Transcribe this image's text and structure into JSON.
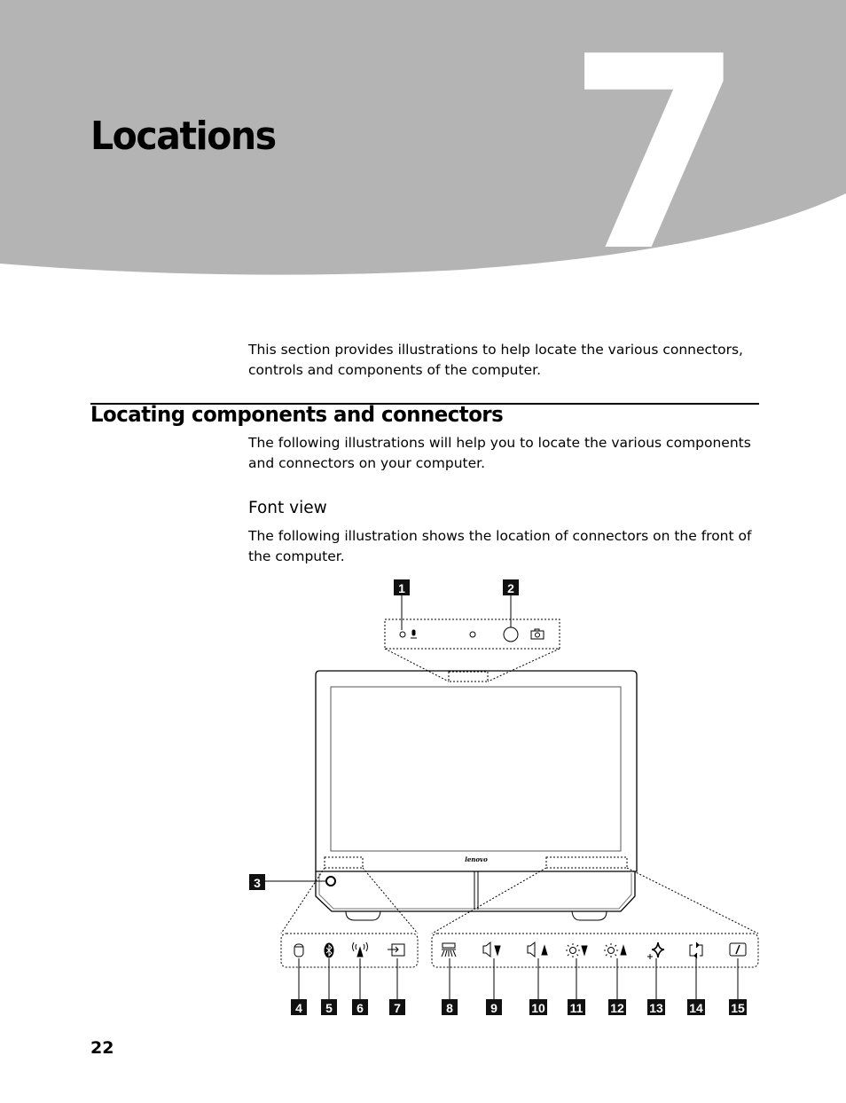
{
  "chapter": {
    "number": "7",
    "title": "Locations",
    "banner_color": "#b4b4b4"
  },
  "intro": "This section provides illustrations to help locate the various connectors, controls and components of the computer.",
  "section": {
    "heading": "Locating components and connectors",
    "text": "The following illustrations will help you to locate the various components and connectors on your computer."
  },
  "subsection": {
    "heading": "Font view",
    "text": "The following illustration shows the location of connectors on the front of the computer."
  },
  "figure": {
    "brand_logo": "lenovo",
    "callouts": [
      {
        "number": "1",
        "icon": "microphone-icon"
      },
      {
        "number": "2",
        "icon": "camera-icon"
      },
      {
        "number": "3",
        "icon": "power-button-icon"
      },
      {
        "number": "4",
        "icon": "hard-drive-indicator-icon"
      },
      {
        "number": "5",
        "icon": "bluetooth-icon"
      },
      {
        "number": "6",
        "icon": "wireless-icon"
      },
      {
        "number": "7",
        "icon": "input-source-icon"
      },
      {
        "number": "8",
        "icon": "backlight-icon"
      },
      {
        "number": "9",
        "icon": "volume-down-icon"
      },
      {
        "number": "10",
        "icon": "volume-up-icon"
      },
      {
        "number": "11",
        "icon": "brightness-down-icon"
      },
      {
        "number": "12",
        "icon": "brightness-up-icon"
      },
      {
        "number": "13",
        "icon": "effects-icon"
      },
      {
        "number": "14",
        "icon": "rotate-icon"
      },
      {
        "number": "15",
        "icon": "display-off-icon"
      }
    ]
  },
  "page_number": "22"
}
